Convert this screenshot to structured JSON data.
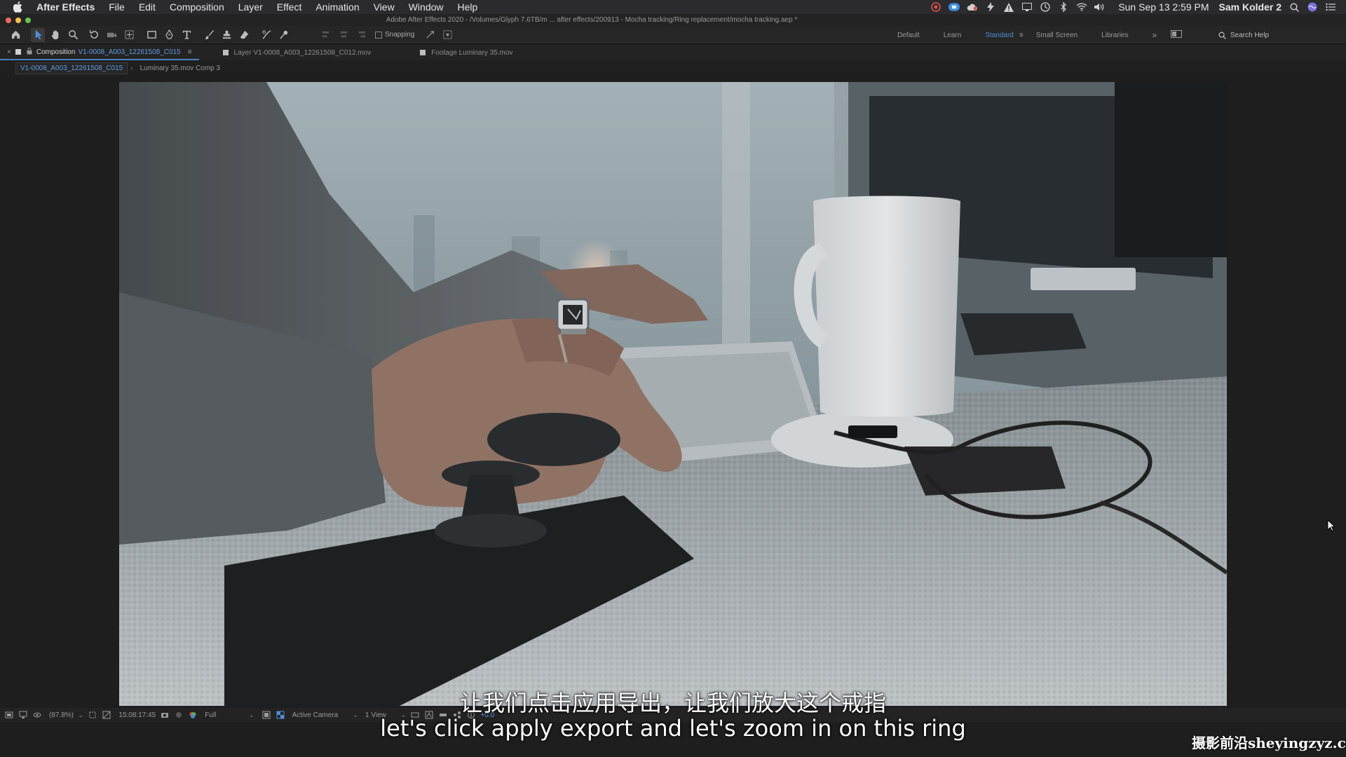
{
  "menubar": {
    "app_name": "After Effects",
    "items": [
      "File",
      "Edit",
      "Composition",
      "Layer",
      "Effect",
      "Animation",
      "View",
      "Window",
      "Help"
    ],
    "clock": "Sun Sep 13  2:59 PM",
    "user": "Sam Kolder 2"
  },
  "window": {
    "title": "Adobe After Effects 2020 - /Volumes/Glyph 7.6TB/m ... after effects/200913 - Mocha tracking/Ring replacement/mocha tracking.aep *"
  },
  "toolbar": {
    "snapping_label": "Snapping",
    "workspaces": [
      "Default",
      "Learn",
      "Standard",
      "Small Screen",
      "Libraries"
    ],
    "active_workspace": "Standard",
    "search_placeholder": "Search Help"
  },
  "panels": {
    "composition_tab_prefix": "Composition",
    "composition_tab_name": "V1-0008_A003_12261508_C015",
    "layer_tab": "Layer V1-0008_A003_12261508_C012.mov",
    "footage_tab": "Footage Luminary 35.mov"
  },
  "breadcrumbs": {
    "active": "V1-0008_A003_12261508_C015",
    "other": "Luminary 35.mov Comp 3"
  },
  "statusbar": {
    "zoom": "(87.8%)",
    "timecode": "15:08:17:45",
    "resolution": "Full",
    "camera": "Active Camera",
    "views": "1 View",
    "exposure": "+0.0"
  },
  "subtitles": {
    "chinese": "让我们点击应用导出，让我们放大这个戒指",
    "english": "let's click apply export and let's zoom in on this ring"
  },
  "watermark": "摄影前沿sheyingzyz.com",
  "colors": {
    "accent_blue": "#4e8fd6",
    "menubar_bg": "#2b2a2c",
    "panel_bg": "#232323"
  },
  "icons": {
    "toolbar": [
      "home-icon",
      "selection-tool-icon",
      "hand-tool-icon",
      "zoom-tool-icon",
      "rotate-tool-icon",
      "camera-tool-icon",
      "pan-behind-icon",
      "rectangle-tool-icon",
      "pen-tool-icon",
      "type-tool-icon",
      "brush-tool-icon",
      "clone-stamp-icon",
      "eraser-tool-icon",
      "roto-brush-icon",
      "puppet-pin-icon"
    ]
  }
}
